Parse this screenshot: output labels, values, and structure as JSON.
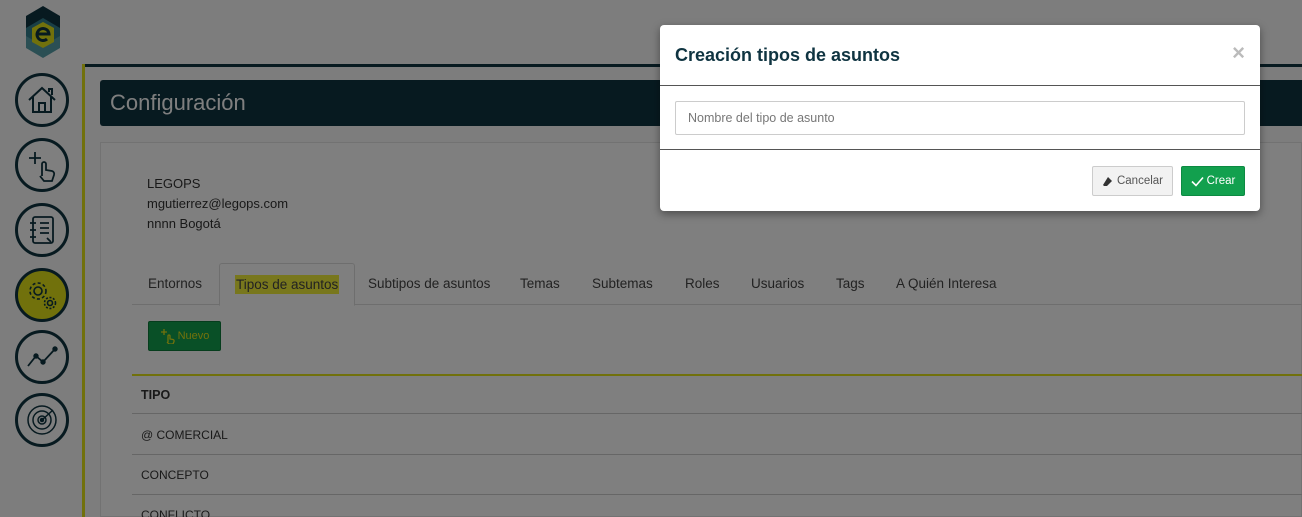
{
  "sidebar": {
    "logo_icon": "legops-logo",
    "items": [
      {
        "name": "home",
        "icon": "home-icon",
        "active": false
      },
      {
        "name": "add",
        "icon": "add-pointer-icon",
        "active": false
      },
      {
        "name": "notebook",
        "icon": "notebook-icon",
        "active": false
      },
      {
        "name": "settings",
        "icon": "gears-icon",
        "active": true
      },
      {
        "name": "analytics",
        "icon": "line-chart-icon",
        "active": false
      },
      {
        "name": "radar",
        "icon": "radar-icon",
        "active": false
      }
    ]
  },
  "header": {
    "title": "Configuración"
  },
  "account": {
    "company": "LEGOPS",
    "email": "mgutierrez@legops.com",
    "location": "nnnn Bogotá"
  },
  "tabs": [
    {
      "label": "Entornos"
    },
    {
      "label": "Tipos de asuntos"
    },
    {
      "label": "Subtipos de asuntos"
    },
    {
      "label": "Temas"
    },
    {
      "label": "Subtemas"
    },
    {
      "label": "Roles"
    },
    {
      "label": "Usuarios"
    },
    {
      "label": "Tags"
    },
    {
      "label": "A Quién Interesa"
    }
  ],
  "active_tab": "Tipos de asuntos",
  "toolbar": {
    "new_label": "Nuevo"
  },
  "table": {
    "header": "TIPO",
    "rows": [
      "@ COMERCIAL",
      "CONCEPTO",
      "CONFLICTO"
    ]
  },
  "modal": {
    "title": "Creación tipos de asuntos",
    "close_label": "×",
    "input_placeholder": "Nombre del tipo de asunto",
    "input_value": "",
    "cancel_label": "Cancelar",
    "create_label": "Crear"
  },
  "colors": {
    "brand_dark": "#0f3441",
    "accent_yellow": "#e3e318",
    "success_green": "#12a04e"
  }
}
